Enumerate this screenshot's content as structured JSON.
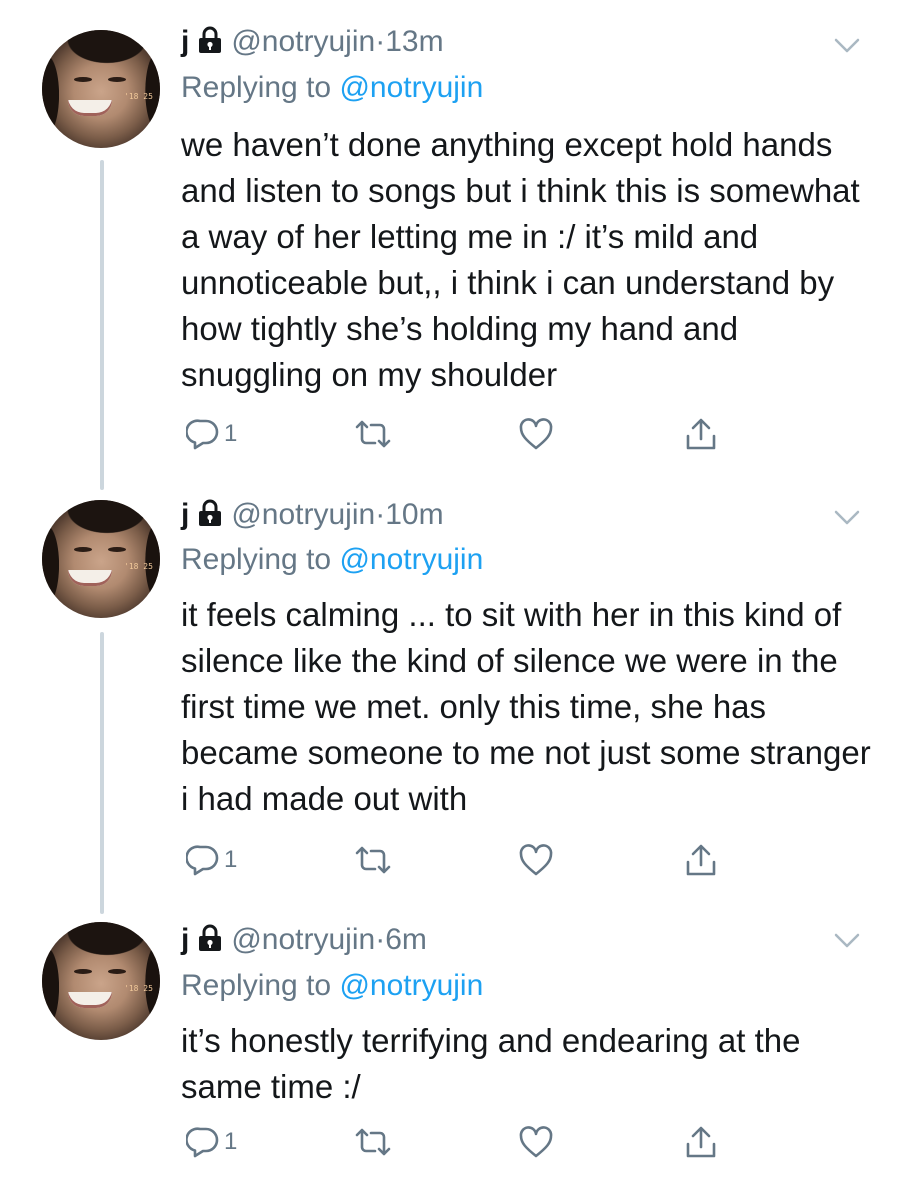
{
  "tweets": [
    {
      "name": "j",
      "handle": "@notryujin",
      "separator": "·",
      "time": "13m",
      "replying_prefix": "Replying to",
      "replying_to": "@notryujin",
      "text": "we haven’t done anything except hold hands and listen to songs but i think this is somewhat a way of her letting me in :/ it’s mild and unnoticeable but,, i think i can understand by how tightly she’s holding my hand and snuggling on my shoulder",
      "reply_count": "1",
      "icons": [
        "lock-icon",
        "chevron-down-icon",
        "reply-icon",
        "retweet-icon",
        "like-icon",
        "share-icon"
      ]
    },
    {
      "name": "j",
      "handle": "@notryujin",
      "separator": "·",
      "time": "10m",
      "replying_prefix": "Replying to",
      "replying_to": "@notryujin",
      "text": "it feels calming ... to sit with her in this kind of silence like the kind of silence we were in the first time we met. only this time, she has became someone to me not just some stranger i had made out with",
      "reply_count": "1",
      "icons": [
        "lock-icon",
        "chevron-down-icon",
        "reply-icon",
        "retweet-icon",
        "like-icon",
        "share-icon"
      ]
    },
    {
      "name": "j",
      "handle": "@notryujin",
      "separator": "·",
      "time": "6m",
      "replying_prefix": "Replying to",
      "replying_to": "@notryujin",
      "text": "it’s honestly terrifying and endearing at the same time :/",
      "reply_count": "1",
      "icons": [
        "lock-icon",
        "chevron-down-icon",
        "reply-icon",
        "retweet-icon",
        "like-icon",
        "share-icon"
      ]
    }
  ],
  "colors": {
    "text": "#14171a",
    "secondary": "#657786",
    "link": "#1da1f2",
    "thread_line": "#ccd6dd"
  }
}
